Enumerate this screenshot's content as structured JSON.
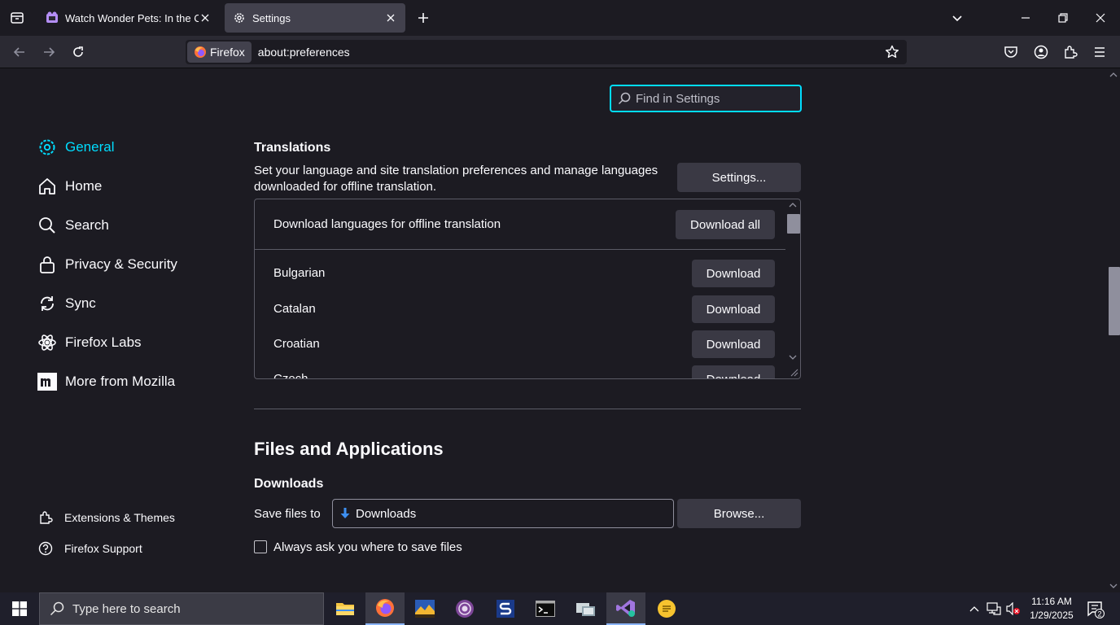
{
  "tabs": [
    {
      "title": "Watch Wonder Pets: In the City",
      "active": false
    },
    {
      "title": "Settings",
      "active": true
    }
  ],
  "urlbar": {
    "identity_label": "Firefox",
    "url": "about:preferences"
  },
  "search": {
    "placeholder": "Find in Settings"
  },
  "sidebar": {
    "items": [
      {
        "label": "General",
        "icon": "gear-icon"
      },
      {
        "label": "Home",
        "icon": "home-icon"
      },
      {
        "label": "Search",
        "icon": "search-icon"
      },
      {
        "label": "Privacy & Security",
        "icon": "lock-icon"
      },
      {
        "label": "Sync",
        "icon": "sync-icon"
      },
      {
        "label": "Firefox Labs",
        "icon": "flask-icon"
      },
      {
        "label": "More from Mozilla",
        "icon": "mozilla-icon"
      }
    ],
    "footer": [
      {
        "label": "Extensions & Themes",
        "icon": "puzzle-icon"
      },
      {
        "label": "Firefox Support",
        "icon": "help-icon"
      }
    ]
  },
  "translations": {
    "heading": "Translations",
    "description": "Set your language and site translation preferences and manage languages downloaded for offline translation.",
    "settings_button": "Settings...",
    "panel_header": "Download languages for offline translation",
    "download_all_button": "Download all",
    "languages": [
      {
        "name": "Bulgarian",
        "button": "Download"
      },
      {
        "name": "Catalan",
        "button": "Download"
      },
      {
        "name": "Croatian",
        "button": "Download"
      },
      {
        "name": "Czech",
        "button": "Download"
      }
    ]
  },
  "files": {
    "heading": "Files and Applications",
    "downloads_heading": "Downloads",
    "save_files_label": "Save files to",
    "save_path": "Downloads",
    "browse_button": "Browse...",
    "always_ask_label": "Always ask you where to save files"
  },
  "taskbar": {
    "search_placeholder": "Type here to search",
    "time": "11:16 AM",
    "date": "1/29/2025",
    "notification_count": "2"
  },
  "colors": {
    "accent": "#00ddff",
    "background": "#1c1b22",
    "toolbar": "#2b2a33"
  }
}
